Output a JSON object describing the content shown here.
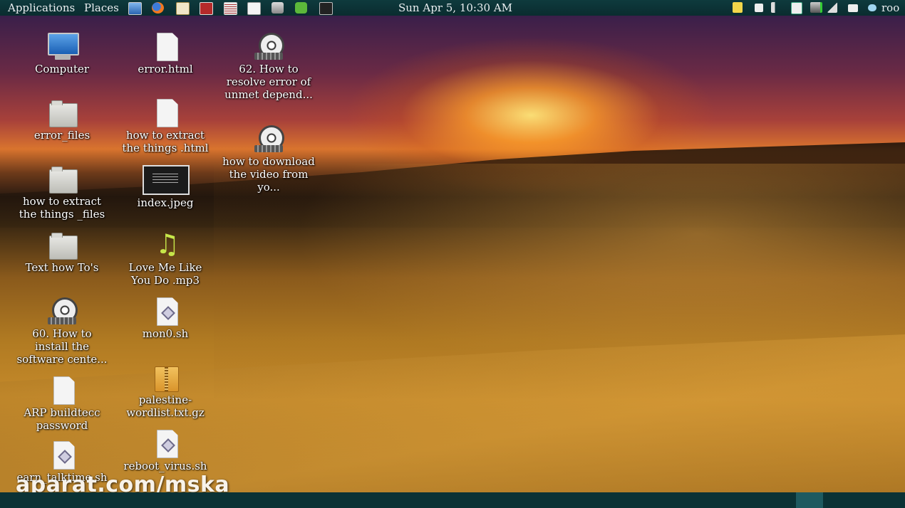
{
  "top_panel": {
    "applications": "Applications",
    "places": "Places",
    "clock": "Sun Apr  5, 10:30 AM",
    "user": "roo",
    "launchers": [
      "monitor-icon",
      "firefox-icon",
      "text-editor-icon",
      "terminal-red-icon",
      "notes-icon",
      "calendar-icon",
      "printer-icon",
      "green-app-icon",
      "terminal-icon"
    ],
    "tray": [
      "folder-tray-icon",
      "stop-icon",
      "volume-icon",
      "clipboard-icon",
      "network-icon",
      "signal-icon",
      "tray-folder-icon",
      "chat-icon"
    ]
  },
  "desktop": {
    "col1": [
      {
        "label": "Computer",
        "type": "computer"
      },
      {
        "label": "error_files",
        "type": "folder"
      },
      {
        "label": "how to extract the things _files",
        "type": "folder"
      },
      {
        "label": "Text how To's",
        "type": "folder"
      },
      {
        "label": "60. How to install the software cente...",
        "type": "video"
      },
      {
        "label": "ARP buildtecc password",
        "type": "file"
      },
      {
        "label": "earn_talktime.sh",
        "type": "script"
      }
    ],
    "col2": [
      {
        "label": "error.html",
        "type": "file"
      },
      {
        "label": "how to extract the things .html",
        "type": "file"
      },
      {
        "label": "index.jpeg",
        "type": "image"
      },
      {
        "label": "Love Me Like You Do .mp3",
        "type": "audio"
      },
      {
        "label": "mon0.sh",
        "type": "script"
      },
      {
        "label": "palestine-wordlist.txt.gz",
        "type": "archive"
      },
      {
        "label": "reboot_virus.sh",
        "type": "script"
      }
    ],
    "col3": [
      {
        "label": "62. How to resolve error of unmet depend...",
        "type": "video"
      },
      {
        "label": "how to download the video from yo...",
        "type": "video"
      }
    ]
  },
  "watermark": "aparat.com/mska"
}
